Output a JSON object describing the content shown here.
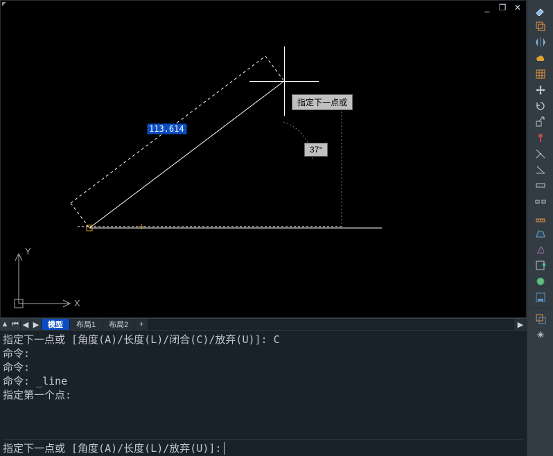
{
  "window_controls": {
    "min": "_",
    "max": "❐",
    "close": "✕"
  },
  "canvas": {
    "prompt_tooltip": "指定下一点或",
    "angle_tooltip": "37°",
    "length_value": "113.6141",
    "ucs": {
      "x_label": "X",
      "y_label": "Y"
    }
  },
  "tabs": {
    "nav_first": "▲",
    "nav_prev_all": "⏮",
    "nav_prev": "◀",
    "nav_next": "▶",
    "active": "模型",
    "layout1": "布局1",
    "layout2": "布局2",
    "add": "+",
    "scroll_right": "▶"
  },
  "cmd": {
    "line0": "指定下一点或 [角度(A)/长度(L)/闭合(C)/放弃(U)]: C",
    "line1": "命令:",
    "line2": "命令:",
    "line3": "命令: _line",
    "line4": "指定第一个点:",
    "prompt_label": "指定下一点或 [角度(A)/长度(L)/放弃(U)]:"
  },
  "tools": {
    "eraser": "eraser",
    "copy": "copy",
    "mirror": "mirror",
    "cloud": "cloud",
    "hatch": "hatch",
    "move": "move",
    "rotate": "rotate",
    "scale": "scale",
    "marker": "marker",
    "trim": "trim",
    "extend": "extend",
    "mline": "mline",
    "break": "break",
    "measure": "measure",
    "area": "area",
    "fit": "fit",
    "bound": "bound",
    "circle": "circle",
    "drawer": "drawer",
    "overlap": "overlap",
    "pan": "pan"
  }
}
